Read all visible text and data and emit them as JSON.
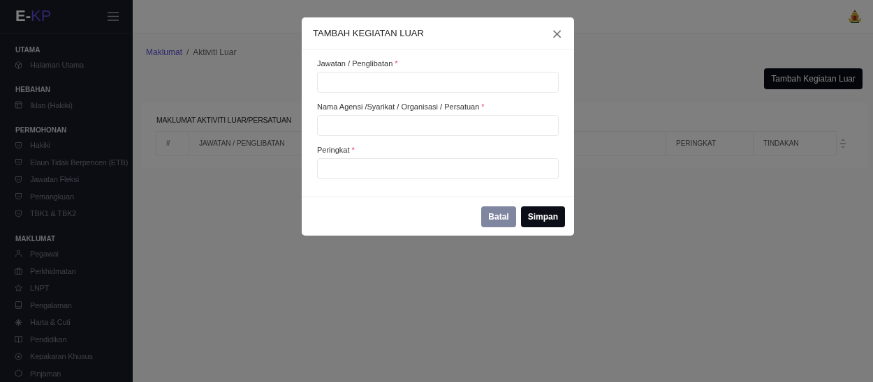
{
  "sidebar": {
    "logo_prefix": "E-",
    "logo_suffix": "KP",
    "sections": [
      {
        "title": "UTAMA",
        "items": [
          {
            "label": "Halaman Utama"
          }
        ]
      },
      {
        "title": "HEBAHAN",
        "items": [
          {
            "label": "Iklan (Hakiki)"
          }
        ]
      },
      {
        "title": "PERMOHONAN",
        "items": [
          {
            "label": "Hakiki"
          },
          {
            "label": "Elaun Tidak Berpencen (ETB)"
          },
          {
            "label": "Jawatan Fleksi"
          },
          {
            "label": "Pemangkuan"
          },
          {
            "label": "TBK1 & TBK2"
          }
        ]
      },
      {
        "title": "MAKLUMAT",
        "items": [
          {
            "label": "Pegawai"
          },
          {
            "label": "Perkhidmatan"
          },
          {
            "label": "LNPT"
          },
          {
            "label": "Pengalaman"
          },
          {
            "label": "Harta & Cuti"
          },
          {
            "label": "Pendidikan"
          },
          {
            "label": "Kepakaran Khusus"
          },
          {
            "label": "Pinjaman"
          }
        ]
      }
    ]
  },
  "breadcrumb_separator": "/",
  "breadcrumb": [
    {
      "label": "Maklumat",
      "kind": "link"
    },
    {
      "label": "Aktiviti Luar",
      "kind": "current"
    }
  ],
  "add_button": "Tambah Kegiatan Luar",
  "card": {
    "title": "MAKLUMAT AKTIVITI LUAR/PERSATUAN",
    "table": {
      "columns": [
        "#",
        "JAWATAN / PENGLIBATAN",
        "PERINGKAT",
        "TINDAKAN"
      ]
    }
  },
  "modal": {
    "title": "TAMBAH KEGIATAN LUAR",
    "close": "×",
    "fields": [
      {
        "label": "Jawatan / Penglibatan",
        "required_mark": "*"
      },
      {
        "label": "Nama Agensi /Syarikat / Organisasi / Persatuan",
        "required_mark": "*"
      },
      {
        "label": "Peringkat",
        "required_mark": "*"
      }
    ],
    "buttons": [
      {
        "label": "Batal",
        "kind": "secondary"
      },
      {
        "label": "Simpan",
        "kind": "primary"
      }
    ]
  }
}
